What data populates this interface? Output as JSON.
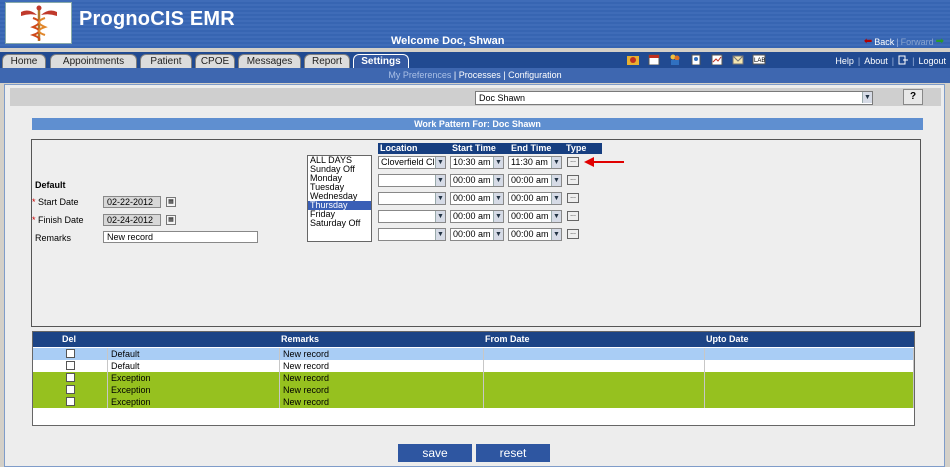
{
  "app": {
    "title": "PrognoCIS EMR",
    "welcome": "Welcome Doc, Shwan",
    "back_label": "Back",
    "forward_label": "Forward"
  },
  "tabs": [
    {
      "label": "Home"
    },
    {
      "label": "Appointments"
    },
    {
      "label": "Patient"
    },
    {
      "label": "CPOE"
    },
    {
      "label": "Messages"
    },
    {
      "label": "Report"
    },
    {
      "label": "Settings",
      "active": true
    }
  ],
  "top_links": {
    "help": "Help",
    "about": "About",
    "logout": "Logout"
  },
  "toolbar_icons": [
    "alert-icon",
    "appointment-icon",
    "patients-icon",
    "user-icon",
    "chart-icon",
    "mail-icon",
    "lab-icon"
  ],
  "subnav": {
    "my_preferences": "My Preferences",
    "processes": "Processes",
    "configuration": "Configuration"
  },
  "provider_select": {
    "value": "Doc Shawn"
  },
  "help_button": "?",
  "work_pattern": {
    "title": "Work Pattern For: Doc Shawn",
    "section_label": "Default",
    "start_date_label": "Start Date",
    "start_date": "02-22-2012",
    "finish_date_label": "Finish Date",
    "finish_date": "02-24-2012",
    "remarks_label": "Remarks",
    "remarks": "New record",
    "days": [
      "ALL DAYS",
      "Sunday Off",
      "Monday",
      "Tuesday",
      "Wednesday",
      "Thursday",
      "Friday",
      "Saturday Off"
    ],
    "selected_day": "Thursday",
    "schedule_headers": {
      "location": "Location",
      "start": "Start Time",
      "end": "End Time",
      "type": "Type"
    },
    "schedule_rows": [
      {
        "location": "Cloverfield Cli",
        "start": "10:30 am",
        "end": "11:30 am"
      },
      {
        "location": "",
        "start": "00:00 am",
        "end": "00:00 am"
      },
      {
        "location": "",
        "start": "00:00 am",
        "end": "00:00 am"
      },
      {
        "location": "",
        "start": "00:00 am",
        "end": "00:00 am"
      },
      {
        "location": "",
        "start": "00:00 am",
        "end": "00:00 am"
      }
    ],
    "type_button": "..."
  },
  "grid": {
    "headers": {
      "del": "Del",
      "type": "",
      "remarks": "Remarks",
      "from": "From Date",
      "upto": "Upto Date"
    },
    "rows": [
      {
        "type": "Default",
        "remarks": "New record",
        "color": "#a9cdf5"
      },
      {
        "type": "Default",
        "remarks": "New record",
        "color": "#ffffff"
      },
      {
        "type": "Exception",
        "remarks": "New record",
        "color": "#96c11f"
      },
      {
        "type": "Exception",
        "remarks": "New record",
        "color": "#96c11f"
      },
      {
        "type": "Exception",
        "remarks": "New record",
        "color": "#96c11f"
      }
    ]
  },
  "buttons": {
    "save": "save",
    "reset": "reset"
  },
  "colors": {
    "header": "#3765b2",
    "tab_active": "#3459a1",
    "grid_header": "#1c4486",
    "exception_row": "#96c11f",
    "default_row_selected": "#a9cdf5",
    "annotation_arrow": "#e00000"
  }
}
